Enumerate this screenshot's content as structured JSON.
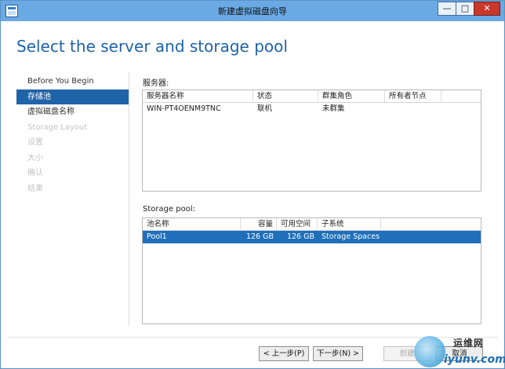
{
  "window": {
    "title": "新建虚拟磁盘向导",
    "min_glyph": "—",
    "max_glyph": "□",
    "close_glyph": "✕"
  },
  "page_heading": "Select the server and storage pool",
  "nav": {
    "items": [
      {
        "label": "Before You Begin",
        "state": "normal"
      },
      {
        "label": "存储池",
        "state": "selected"
      },
      {
        "label": "虚拟磁盘名称",
        "state": "normal"
      },
      {
        "label": "Storage Layout",
        "state": "disabled"
      },
      {
        "label": "设置",
        "state": "disabled"
      },
      {
        "label": "大小",
        "state": "disabled"
      },
      {
        "label": "确认",
        "state": "disabled"
      },
      {
        "label": "结果",
        "state": "disabled"
      }
    ]
  },
  "server_section": {
    "label": "服务器:",
    "columns": [
      "服务器名称",
      "状态",
      "群集角色",
      "所有者节点"
    ],
    "rows": [
      [
        "WIN-PT4OENM9TNC",
        "联机",
        "未群集",
        ""
      ]
    ]
  },
  "pool_section": {
    "label": "Storage pool:",
    "columns": [
      "池名称",
      "容量",
      "可用空间",
      "子系统"
    ],
    "rows": [
      [
        "Pool1",
        "126 GB",
        "126 GB",
        "Storage Spaces"
      ]
    ],
    "selected_row": 0
  },
  "buttons": {
    "prev": "< 上一步(P)",
    "next": "下一步(N) >",
    "create": "创建",
    "cancel": "取消"
  },
  "watermark": {
    "top": "运维网",
    "bottom": "iyunv.com"
  },
  "colors": {
    "accent": "#1f63a8",
    "selection": "#1f6fba",
    "titlebar": "#6aa9e4",
    "close": "#c8382d"
  }
}
